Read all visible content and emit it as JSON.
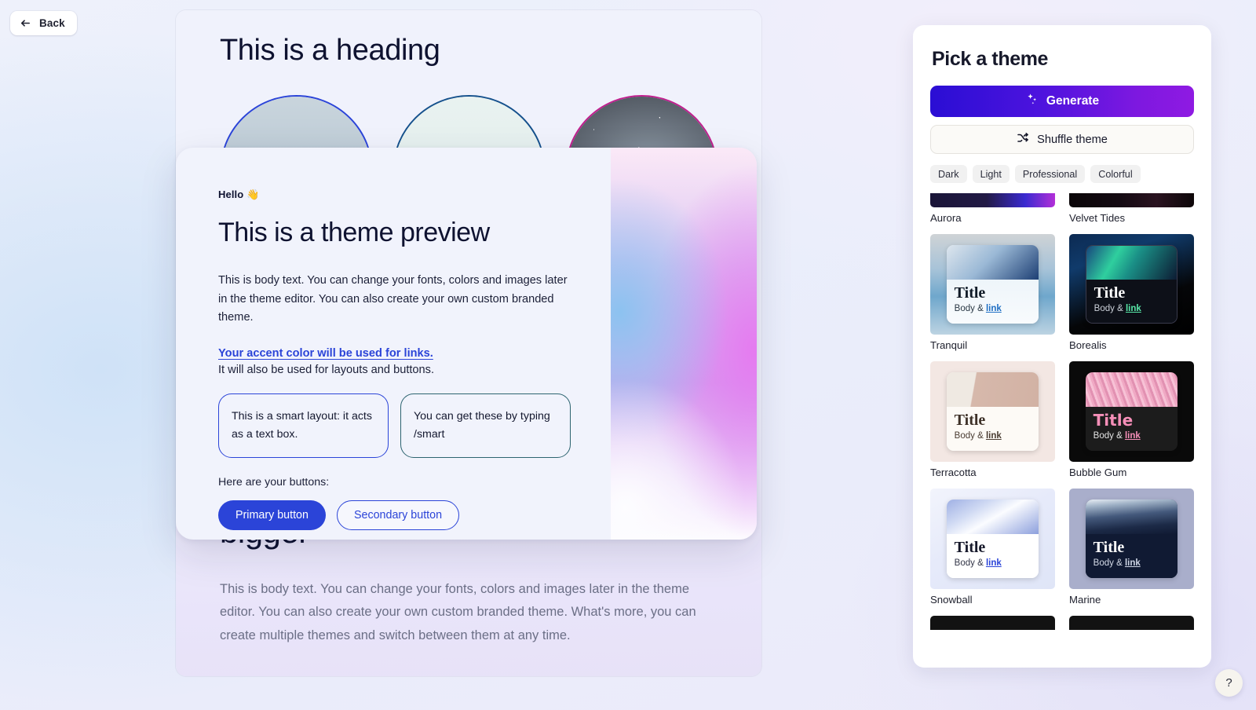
{
  "nav": {
    "back_label": "Back",
    "back_icon": "arrow-left-icon"
  },
  "document": {
    "heading": "This is a heading",
    "subheading": "bigger",
    "body": "This is body text. You can change your fonts, colors and images later in the theme editor. You can also create your own custom branded theme. What's more, you can create multiple themes and switch between them at any time.",
    "circles": [
      {
        "name": "mountain-photo",
        "border_color": "#2b44d8"
      },
      {
        "name": "tent-photo",
        "border_color": "#15518c"
      },
      {
        "name": "starfield-photo",
        "border_color": "#c01f8e"
      }
    ]
  },
  "preview": {
    "greeting": "Hello 👋",
    "title": "This is a theme preview",
    "body": "This is body text. You can change your fonts, colors and images later in the theme editor. You can also create your own custom branded theme.",
    "accent_link": "Your accent color will be used for links.",
    "accent_note": "It will also be used for layouts and buttons.",
    "smart_boxes": [
      "This is a smart layout: it acts as a text box.",
      "You can get these by typing /smart"
    ],
    "buttons_label": "Here are your buttons:",
    "primary_button": "Primary button",
    "secondary_button": "Secondary button",
    "accent_color": "#2b44d8",
    "secondary_box_color": "#2d6470"
  },
  "panel": {
    "title": "Pick a theme",
    "generate_label": "Generate",
    "generate_icon": "sparkles-icon",
    "shuffle_label": "Shuffle theme",
    "shuffle_icon": "shuffle-icon",
    "chips": [
      "Dark",
      "Light",
      "Professional",
      "Colorful"
    ],
    "card_title": "Title",
    "card_body_prefix": "Body & ",
    "card_link": "link",
    "themes": [
      {
        "name": "Aurora",
        "clip": "top"
      },
      {
        "name": "Velvet Tides",
        "clip": "top"
      },
      {
        "name": "Tranquil",
        "clip": "none"
      },
      {
        "name": "Borealis",
        "clip": "none"
      },
      {
        "name": "Terracotta",
        "clip": "none"
      },
      {
        "name": "Bubble Gum",
        "clip": "none"
      },
      {
        "name": "Snowball",
        "clip": "none"
      },
      {
        "name": "Marine",
        "clip": "none"
      },
      {
        "name": "",
        "clip": "bottom"
      },
      {
        "name": "",
        "clip": "bottom"
      }
    ]
  },
  "help": {
    "label": "?"
  }
}
